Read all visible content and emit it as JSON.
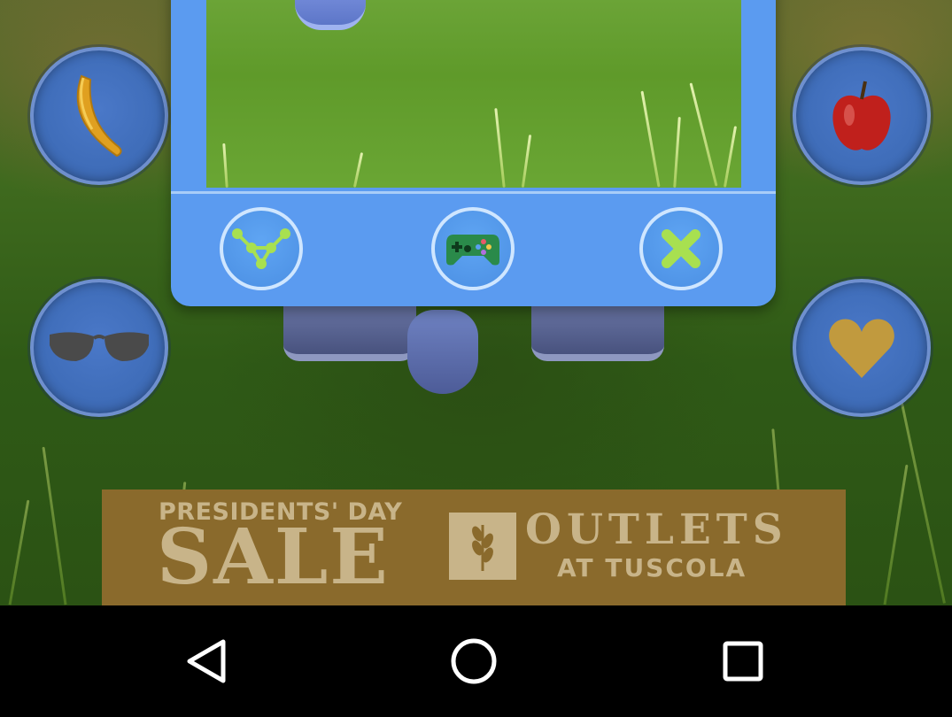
{
  "colors": {
    "dialog_blue": "#5b9bf0",
    "button_blue": "#4a78c8",
    "ad_background": "#8a6a2c",
    "ad_text": "#c8b489",
    "nav_background": "#000000"
  },
  "side_buttons": {
    "left": [
      "banana-icon",
      "sunglasses-icon"
    ],
    "right": [
      "apple-icon",
      "heart-icon"
    ]
  },
  "dialog": {
    "preview": "game-preview-grass",
    "buttons": [
      "share-icon",
      "gamepad-icon",
      "close-icon"
    ]
  },
  "ad": {
    "line1": "PRESIDENTS' DAY",
    "line2": "SALE",
    "brand_line1": "OUTLETS",
    "brand_line2": "AT TUSCOLA"
  },
  "navbar": {
    "buttons": [
      "back-icon",
      "home-icon",
      "recents-icon"
    ]
  }
}
